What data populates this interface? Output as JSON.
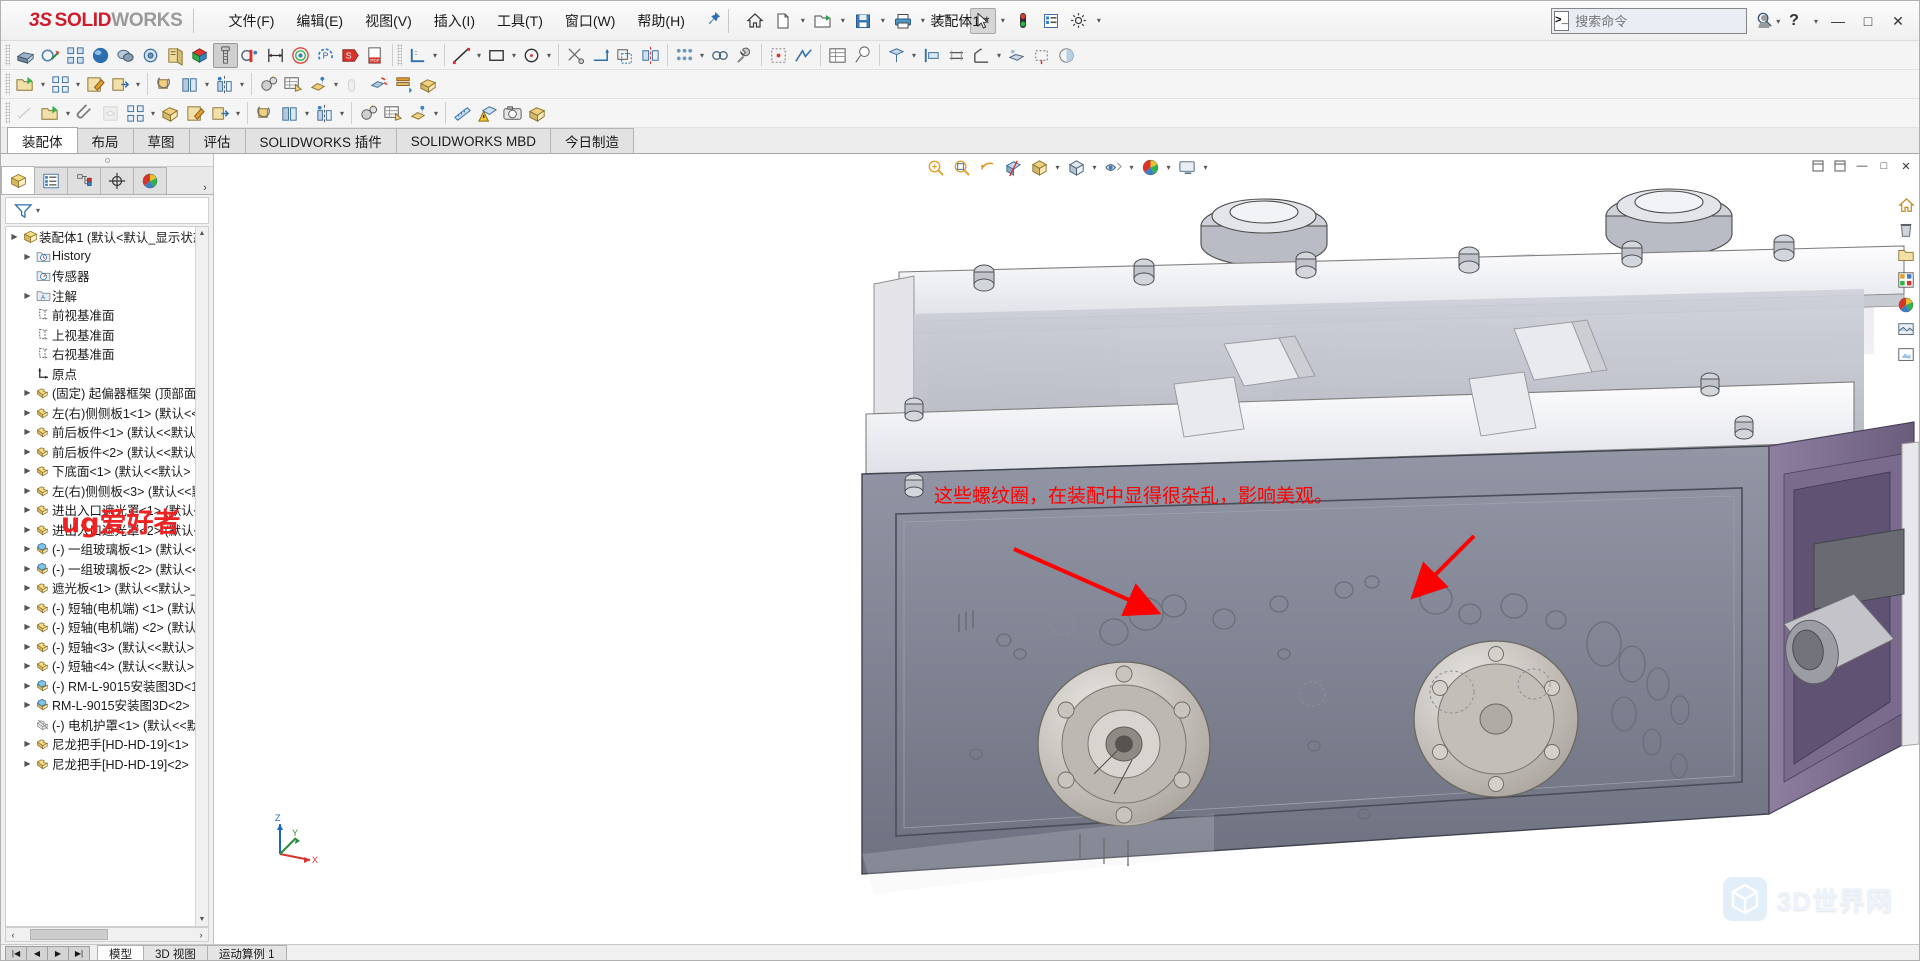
{
  "app": {
    "brand_ds": "3S",
    "brand_solid": "SOLID",
    "brand_works": "WORKS",
    "document_title": "装配体1 *",
    "accent_red": "#cf1b2b",
    "annotation_red": "#ff0000"
  },
  "menubar": {
    "items": [
      {
        "label": "文件(F)"
      },
      {
        "label": "编辑(E)"
      },
      {
        "label": "视图(V)"
      },
      {
        "label": "插入(I)"
      },
      {
        "label": "工具(T)"
      },
      {
        "label": "窗口(W)"
      },
      {
        "label": "帮助(H)"
      }
    ],
    "pin_icon": "pushpin-icon"
  },
  "quick_access": {
    "buttons": [
      {
        "name": "home-icon",
        "label": "主页"
      },
      {
        "name": "new-document-icon",
        "label": "新建"
      },
      {
        "name": "open-document-icon",
        "label": "打开"
      },
      {
        "name": "save-icon",
        "label": "保存"
      },
      {
        "name": "print-icon",
        "label": "打印"
      },
      {
        "name": "undo-icon",
        "label": "撤销"
      },
      {
        "name": "select-cursor-icon",
        "label": "选择"
      },
      {
        "name": "rebuild-icon",
        "label": "重建模型"
      },
      {
        "name": "file-properties-icon",
        "label": "文件属性"
      },
      {
        "name": "options-gear-icon",
        "label": "选项"
      }
    ]
  },
  "search": {
    "placeholder": "搜索命令",
    "value": "",
    "icon": "search-magnifier-icon"
  },
  "window_controls": {
    "user_icon": "user-account-icon",
    "help_icon": "help-question-icon",
    "minimize": "—",
    "maximize": "□",
    "close": "✕"
  },
  "command_tabs": {
    "items": [
      {
        "label": "装配体",
        "selected": true
      },
      {
        "label": "布局",
        "selected": false
      },
      {
        "label": "草图",
        "selected": false
      },
      {
        "label": "评估",
        "selected": false
      },
      {
        "label": "SOLIDWORKS 插件",
        "selected": false
      },
      {
        "label": "SOLIDWORKS MBD",
        "selected": false
      },
      {
        "label": "今日制造",
        "selected": false
      }
    ]
  },
  "toolbar_row1": {
    "icons": [
      "insert-components-icon",
      "mate-icon",
      "component-pattern-icon",
      "smart-fasteners-icon",
      "move-component-icon",
      "assembly-features-icon",
      "new-motion-study-icon",
      "exploded-view-icon",
      "bolt-fastener-icon",
      "interference-detection-icon",
      "measure-icon",
      "section-view-icon",
      "performance-evaluation-icon",
      "sensors-icon",
      "simulation-icon",
      "pdf-3d-icon",
      "sketch-corner-icon"
    ]
  },
  "toolbar_row2": {
    "icons": [
      "open-assembly-icon",
      "component-pattern2-icon",
      "edit-component-icon",
      "derived-part-icon",
      "rotate-component-icon",
      "linear-pattern-icon",
      "mirror-component-icon",
      "gear-mate-icon",
      "bom-table-icon",
      "belt-chain-icon",
      "drag-move-icon",
      "explode-line-icon",
      "smart-component-icon",
      "assembly-visualization-icon"
    ]
  },
  "toolbar_row3": {
    "icons": [
      "smart-dimension-icon",
      "open-folder-icon",
      "paperclip-icon",
      "hide-show-icon",
      "pattern-icon",
      "assembly-envelope-icon",
      "edit-assembly-icon",
      "export-icon",
      "rotate-icon",
      "linear-component-pattern-icon",
      "mirror-icon",
      "gear-icon",
      "bom-icon",
      "belt-icon",
      "measure-ruler-icon",
      "interference-warning-icon",
      "camera-icon",
      "package-icon"
    ]
  },
  "left_panel": {
    "tabs": [
      {
        "name": "feature-manager-tree-tab",
        "icon": "yellow-cube-icon",
        "selected": true
      },
      {
        "name": "property-manager-tab",
        "icon": "list-panel-icon",
        "selected": false
      },
      {
        "name": "configuration-manager-tab",
        "icon": "config-tree-icon",
        "selected": false
      },
      {
        "name": "dimxpert-manager-tab",
        "icon": "crosshair-icon",
        "selected": false
      },
      {
        "name": "display-manager-tab",
        "icon": "color-wheel-icon",
        "selected": false
      }
    ],
    "expand_arrow": "›",
    "filter_icon": "filter-funnel-icon",
    "tree": [
      {
        "indent": 0,
        "arrow": true,
        "icon": "assembly-icon",
        "label": "装配体1  (默认<默认_显示状态"
      },
      {
        "indent": 1,
        "arrow": true,
        "icon": "history-icon",
        "label": "History"
      },
      {
        "indent": 1,
        "arrow": false,
        "icon": "sensor-icon",
        "label": "传感器"
      },
      {
        "indent": 1,
        "arrow": true,
        "icon": "annotation-icon",
        "label": "注解"
      },
      {
        "indent": 1,
        "arrow": false,
        "icon": "plane-icon",
        "label": "前视基准面"
      },
      {
        "indent": 1,
        "arrow": false,
        "icon": "plane-icon",
        "label": "上视基准面"
      },
      {
        "indent": 1,
        "arrow": false,
        "icon": "plane-icon",
        "label": "右视基准面"
      },
      {
        "indent": 1,
        "arrow": false,
        "icon": "origin-icon",
        "label": "原点"
      },
      {
        "indent": 1,
        "arrow": true,
        "icon": "part-icon",
        "label": "(固定) 起偏器框架  (顶部面"
      },
      {
        "indent": 1,
        "arrow": true,
        "icon": "part-icon",
        "label": "左(右)侧侧板1<1> (默认<<"
      },
      {
        "indent": 1,
        "arrow": true,
        "icon": "part-icon",
        "label": "前后板件<1> (默认<<默认"
      },
      {
        "indent": 1,
        "arrow": true,
        "icon": "part-icon",
        "label": "前后板件<2> (默认<<默认"
      },
      {
        "indent": 1,
        "arrow": true,
        "icon": "part-icon",
        "label": "下底面<1> (默认<<默认>"
      },
      {
        "indent": 1,
        "arrow": true,
        "icon": "part-icon",
        "label": "左(右)侧侧板<3> (默认<<默"
      },
      {
        "indent": 1,
        "arrow": true,
        "icon": "part-icon",
        "label": "进出入口遮光罩<1> (默认<"
      },
      {
        "indent": 1,
        "arrow": true,
        "icon": "part-icon",
        "label": "进出入口遮光罩<2> (默认<"
      },
      {
        "indent": 1,
        "arrow": true,
        "icon": "subassembly-icon",
        "label": "(-) 一组玻璃板<1> (默认<<"
      },
      {
        "indent": 1,
        "arrow": true,
        "icon": "subassembly-icon",
        "label": "(-) 一组玻璃板<2> (默认<<默"
      },
      {
        "indent": 1,
        "arrow": true,
        "icon": "part-icon",
        "label": "遮光板<1> (默认<<默认>_"
      },
      {
        "indent": 1,
        "arrow": true,
        "icon": "part-icon",
        "label": "(-) 短轴(电机端)  <1> (默认"
      },
      {
        "indent": 1,
        "arrow": true,
        "icon": "part-icon",
        "label": "(-) 短轴(电机端)  <2> (默认"
      },
      {
        "indent": 1,
        "arrow": true,
        "icon": "part-icon",
        "label": "(-) 短轴<3> (默认<<默认>"
      },
      {
        "indent": 1,
        "arrow": true,
        "icon": "part-icon",
        "label": "(-) 短轴<4> (默认<<默认>"
      },
      {
        "indent": 1,
        "arrow": true,
        "icon": "subassembly-icon",
        "label": "(-) RM-L-9015安装图3D<1"
      },
      {
        "indent": 1,
        "arrow": true,
        "icon": "subassembly-icon",
        "label": "RM-L-9015安装图3D<2>"
      },
      {
        "indent": 1,
        "arrow": false,
        "icon": "hidden-part-icon",
        "label": "(-) 电机护罩<1> (默认<<默"
      },
      {
        "indent": 1,
        "arrow": true,
        "icon": "part-icon",
        "label": "尼龙把手[HD-HD-19]<1>"
      },
      {
        "indent": 1,
        "arrow": true,
        "icon": "part-icon",
        "label": "尼龙把手[HD-HD-19]<2>"
      }
    ]
  },
  "viewport": {
    "toolbar_icons": [
      "zoom-to-fit-icon",
      "zoom-to-area-icon",
      "previous-view-icon",
      "section-view-icon",
      "view-orientation-icon",
      "display-style-icon",
      "hide-show-items-icon",
      "apply-scene-icon",
      "view-settings-icon"
    ],
    "window_buttons": [
      "restore-icon",
      "maximize-icon",
      "minimize-icon",
      "close-icon"
    ],
    "right_strip_icons": [
      "view-home-icon",
      "delete-icon",
      "folder-icon",
      "appearance-icon",
      "material-sphere-icon",
      "scene-icon",
      "decal-icon",
      "lights-icon"
    ],
    "annotation_text": "这些螺纹圈，在装配中显得很杂乱，影响美观。",
    "triad_labels": {
      "x": "X",
      "y": "Y",
      "z": "Z"
    }
  },
  "watermarks": {
    "ug_text": "ug爱好者",
    "site_text": "3D世界网"
  },
  "bottom_bar": {
    "nav_buttons": [
      "|◀",
      "◀",
      "▶",
      "▶|"
    ],
    "tabs": [
      {
        "label": "模型",
        "selected": true
      },
      {
        "label": "3D 视图",
        "selected": false
      },
      {
        "label": "运动算例 1",
        "selected": false
      }
    ]
  }
}
